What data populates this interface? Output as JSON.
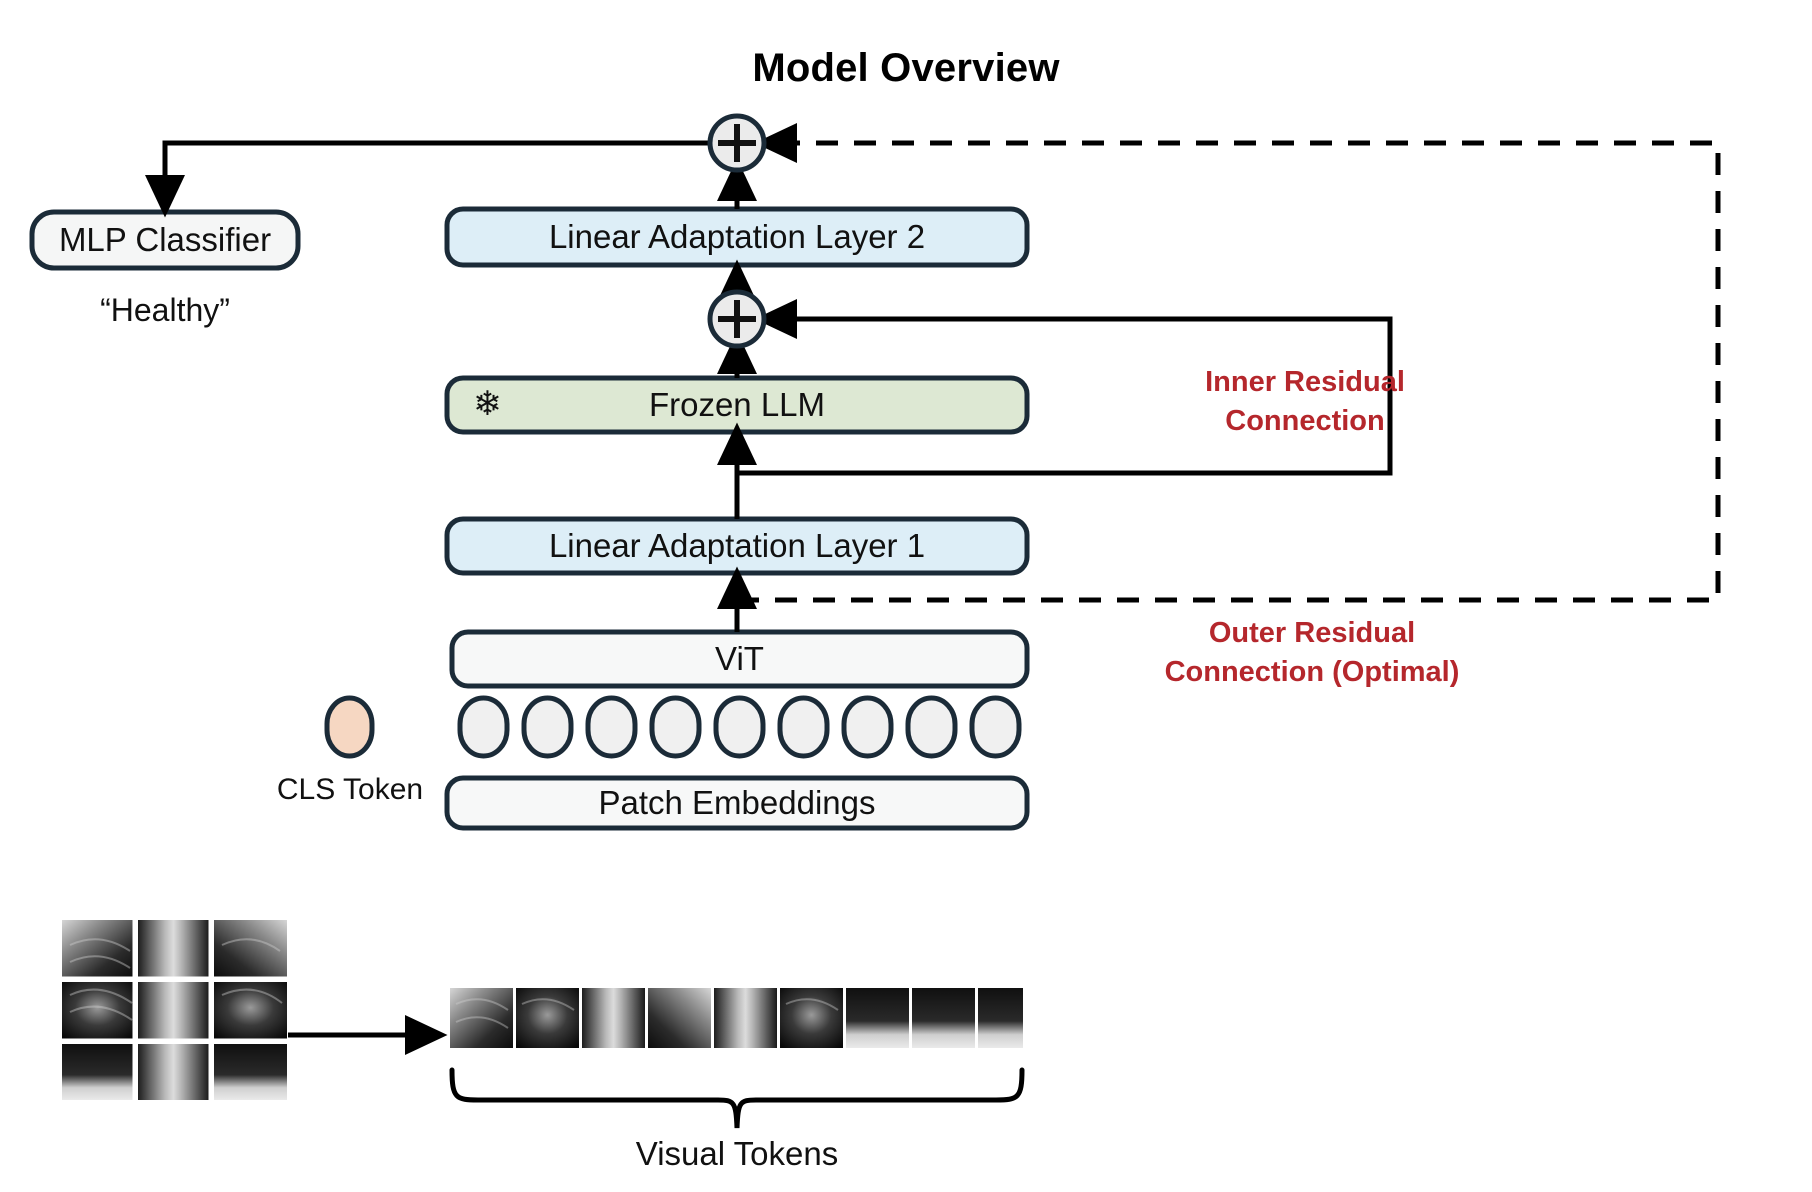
{
  "title": "Model Overview",
  "nodes": {
    "mlp_classifier": "MLP Classifier",
    "prediction": "“Healthy”",
    "linear_layer_2": "Linear Adaptation Layer 2",
    "frozen_llm": "Frozen LLM",
    "linear_layer_1": "Linear Adaptation Layer 1",
    "vit": "ViT",
    "patch_embeddings": "Patch Embeddings",
    "cls_token": "CLS Token",
    "visual_tokens": "Visual Tokens"
  },
  "annotations": {
    "inner_residual": "Inner Residual\nConnection",
    "inner_residual_line1": "Inner Residual",
    "inner_residual_line2": "Connection",
    "outer_residual_line1": "Outer Residual",
    "outer_residual_line2": "Connection (Optimal)"
  },
  "icons": {
    "frozen": "❄",
    "plus_top": "+",
    "plus_mid": "+"
  },
  "colors": {
    "outline": "#1b2b38",
    "adaptation_fill": "#ddeef7",
    "llm_fill": "#dde8d3",
    "neutral_fill": "#f5f6f6",
    "cls_fill": "#f6d7c2",
    "accent_red": "#b5272c",
    "stroke_black": "#000000"
  },
  "counts": {
    "visual_token_pills": 9,
    "image_patches": 9,
    "xray_grid_cells": 9
  }
}
